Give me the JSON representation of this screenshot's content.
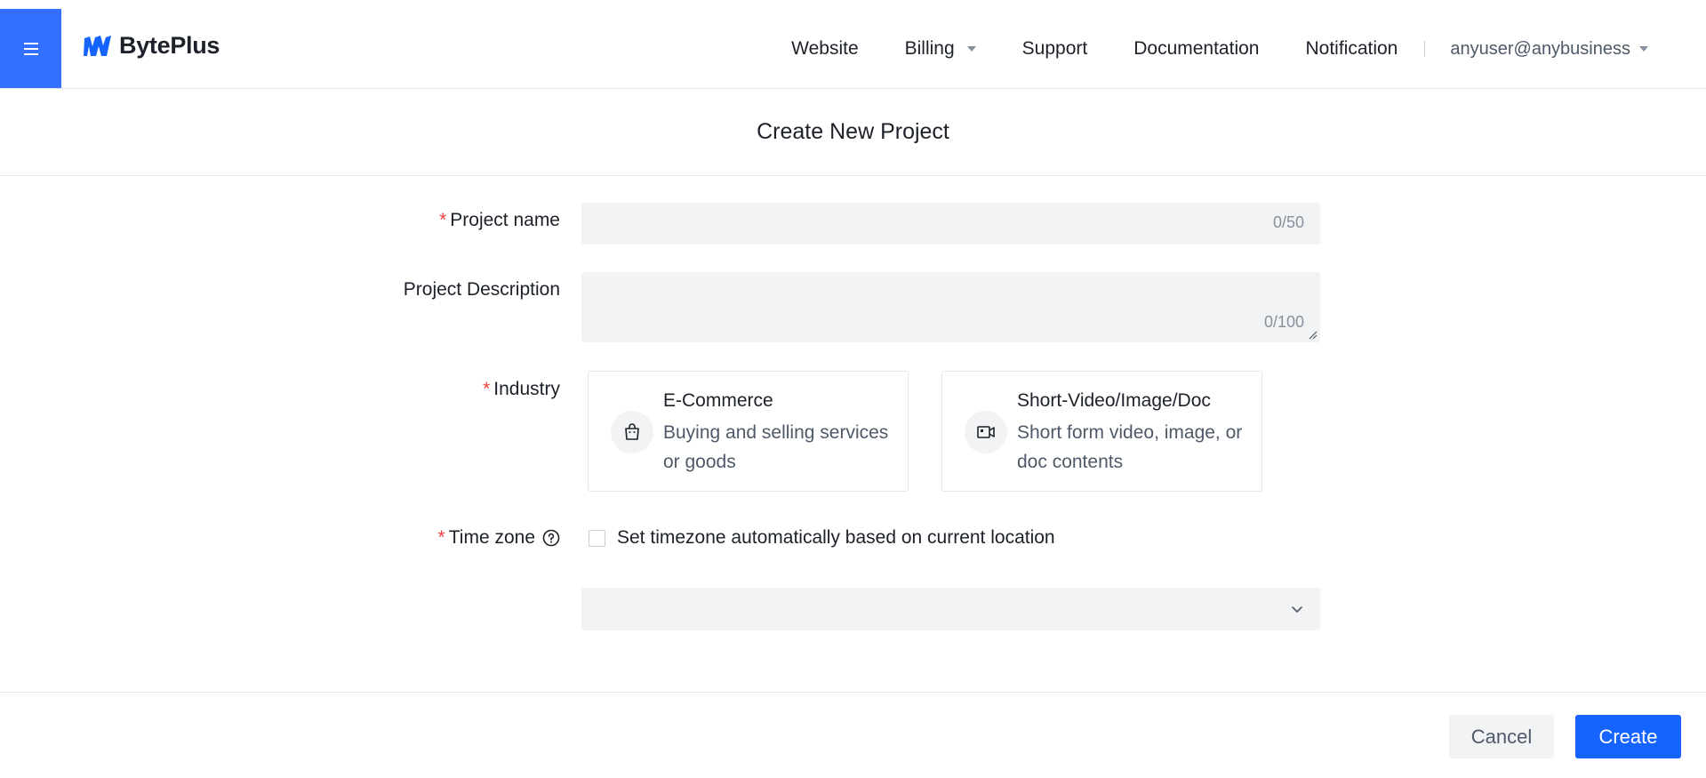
{
  "header": {
    "brand": "BytePlus",
    "nav": [
      {
        "label": "Website"
      },
      {
        "label": "Billing",
        "has_dropdown": true
      },
      {
        "label": "Support"
      },
      {
        "label": "Documentation"
      },
      {
        "label": "Notification"
      }
    ],
    "user": "anyuser@anybusiness",
    "accent_color": "#3370ff"
  },
  "page": {
    "title": "Create New Project"
  },
  "form": {
    "project_name": {
      "label": "Project name",
      "required": "*",
      "value": "",
      "counter": "0/50"
    },
    "project_description": {
      "label": "Project Description",
      "value": "",
      "counter": "0/100"
    },
    "industry": {
      "label": "Industry",
      "required": "*",
      "options": [
        {
          "title": "E-Commerce",
          "description": "Buying and selling services or goods",
          "icon": "shopping-bag-icon"
        },
        {
          "title": "Short-Video/Image/Doc",
          "description": "Short form video, image, or doc contents",
          "icon": "video-camera-icon"
        }
      ]
    },
    "time_zone": {
      "label": "Time zone",
      "required": "*",
      "auto_label": "Set timezone automatically based on current location",
      "auto_checked": false,
      "selected": ""
    }
  },
  "footer": {
    "cancel_label": "Cancel",
    "create_label": "Create",
    "primary_color": "#1664ff"
  }
}
